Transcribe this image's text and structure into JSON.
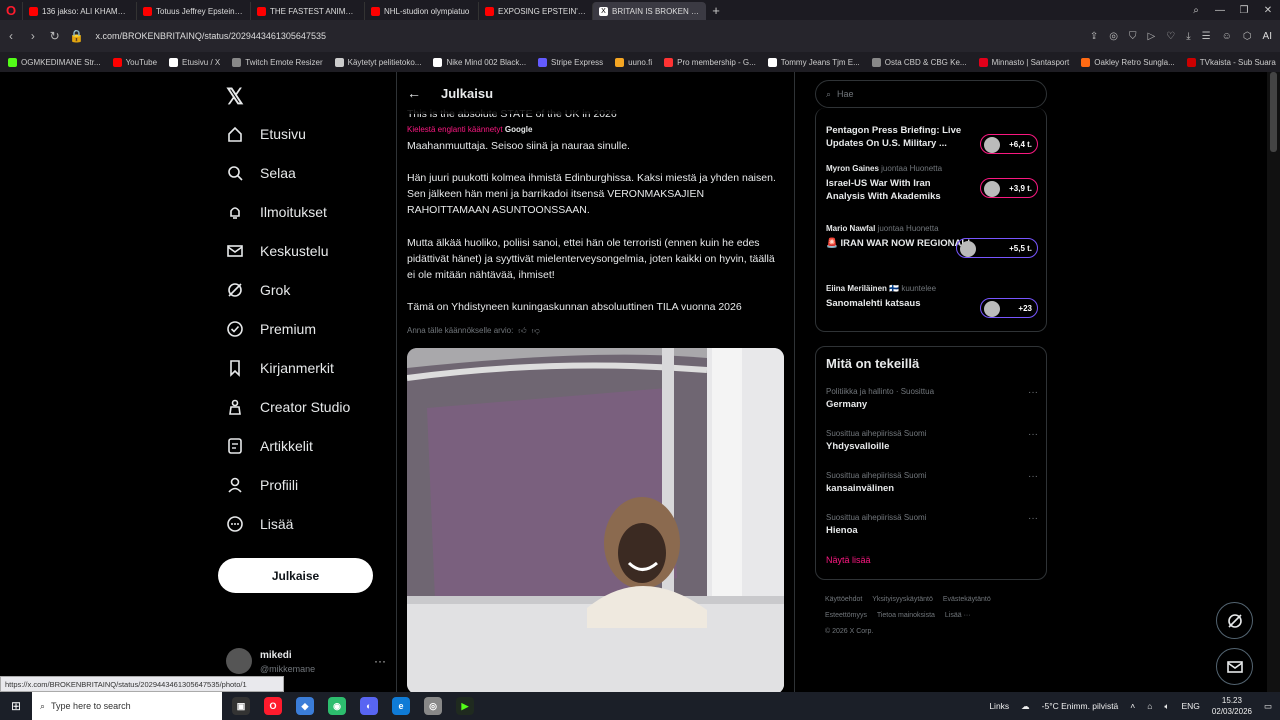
{
  "tabs": [
    {
      "label": "136 jakso: ALI KHAMENEI",
      "icon": "youtube-icon",
      "active": false
    },
    {
      "label": "Totuus Jeffrey Epsteinin K",
      "icon": "youtube-icon",
      "active": false
    },
    {
      "label": "THE FASTEST ANIMATRON",
      "icon": "youtube-icon",
      "active": false
    },
    {
      "label": "NHL-studion olympiatuo",
      "icon": "youtube-icon",
      "active": false
    },
    {
      "label": "EXPOSING EPSTEIN'S ZOR",
      "icon": "youtube-icon",
      "active": false
    },
    {
      "label": "BRITAIN IS BROKEN 🇬🇧 X",
      "icon": "x-icon",
      "active": true
    }
  ],
  "address": {
    "url": "x.com/BROKENBRITAINQ/status/2029443461305647535",
    "ai_label": "AI"
  },
  "bookmarks": [
    {
      "label": "OGMKEDIMANE Str...",
      "color": "#53fc18"
    },
    {
      "label": "YouTube",
      "color": "#ff0000"
    },
    {
      "label": "Etusivu / X",
      "color": "#ffffff"
    },
    {
      "label": "Twitch Emote Resizer",
      "color": "#888888"
    },
    {
      "label": "Käytetyt pelitietoko...",
      "color": "#cccccc"
    },
    {
      "label": "Nike Mind 002 Black...",
      "color": "#ffffff"
    },
    {
      "label": "Stripe Express",
      "color": "#635bff"
    },
    {
      "label": "uuno.fi",
      "color": "#f5a623"
    },
    {
      "label": "Pro membership - G...",
      "color": "#ff3333"
    },
    {
      "label": "Tommy Jeans Tjm E...",
      "color": "#ffffff"
    },
    {
      "label": "Osta CBD & CBG Ke...",
      "color": "#888888"
    },
    {
      "label": "Minnasto | Santasport",
      "color": "#e2001a"
    },
    {
      "label": "Oakley Retro Sungla...",
      "color": "#ff6a13"
    },
    {
      "label": "TVkaista - Sub Suara",
      "color": "#cc0000"
    }
  ],
  "nav": [
    {
      "label": "Etusivu",
      "icon": "home-icon"
    },
    {
      "label": "Selaa",
      "icon": "search-icon"
    },
    {
      "label": "Ilmoitukset",
      "icon": "bell-icon"
    },
    {
      "label": "Keskustelu",
      "icon": "mail-icon"
    },
    {
      "label": "Grok",
      "icon": "grok-icon"
    },
    {
      "label": "Premium",
      "icon": "premium-icon"
    },
    {
      "label": "Kirjanmerkit",
      "icon": "bookmark-icon"
    },
    {
      "label": "Creator Studio",
      "icon": "creator-icon"
    },
    {
      "label": "Artikkelit",
      "icon": "article-icon"
    },
    {
      "label": "Profiili",
      "icon": "profile-icon"
    },
    {
      "label": "Lisää",
      "icon": "more-icon"
    }
  ],
  "post_button": "Julkaise",
  "account": {
    "name": "mikedi",
    "handle": "@mikkemane"
  },
  "tweet": {
    "header": "Julkaisu",
    "original_line": "This is the absolute STATE of the UK in 2026",
    "translated_from": "Kielestä englanti käännetyt",
    "translated_by": "Google",
    "para1": "Maahanmuuttaja. Seisoo siinä ja nauraa sinulle.",
    "para2": "Hän juuri puukotti kolmea ihmistä Edinburghissa. Kaksi miestä ja yhden naisen. Sen jälkeen hän meni ja barrikadoi itsensä VERONMAKSAJIEN RAHOITTAMAAN ASUNTOONSSAAN.",
    "para3": "Mutta älkää huoliko, poliisi sanoi, ettei hän ole terroristi (ennen kuin he edes pidättivät hänet) ja syyttivät mielenterveysongelmia, joten kaikki on hyvin, täällä ei ole mitään nähtävää, ihmiset!",
    "para4": "Tämä on Yhdistyneen kuningaskunnan absoluuttinen TILA vuonna 2026",
    "rate_prompt": "Anna tälle käännökselle arvio:"
  },
  "search": {
    "placeholder": "Hae"
  },
  "live": [
    {
      "host": "",
      "host_suffix": "",
      "title": "Pentagon Press Briefing: Live Updates On U.S. Military ...",
      "count": "+6,4 t."
    },
    {
      "host": "Myron Gaines",
      "host_suffix": "juontaa Huonetta",
      "title": "Israel-US War With Iran Analysis With Akademiks",
      "count": "+3,9 t."
    },
    {
      "host": "Mario Nawfal",
      "host_suffix": "juontaa Huonetta",
      "title": "🚨 IRAN WAR NOW REGIONAL!",
      "count": "+5,5 t."
    },
    {
      "host": "Eiina Meriläinen 🇫🇮",
      "host_suffix": "kuuntelee",
      "title": "Sanomalehti katsaus",
      "count": "+23"
    }
  ],
  "trends": {
    "heading": "Mitä on tekeillä",
    "items": [
      {
        "context": "Politiikka ja hallinto · Suosittua",
        "name": "Germany"
      },
      {
        "context": "Suosittua aihepiirissä Suomi",
        "name": "Yhdysvalloille"
      },
      {
        "context": "Suosittua aihepiirissä Suomi",
        "name": "kansainvälinen"
      },
      {
        "context": "Suosittua aihepiirissä Suomi",
        "name": "Hienoa"
      }
    ],
    "show_more": "Näytä lisää"
  },
  "footer": [
    "Käyttöehdot",
    "Yksityisyyskäytäntö",
    "Evästekäytäntö",
    "Esteettömyys",
    "Tietoa mainoksista",
    "Lisää ···",
    "© 2026 X Corp."
  ],
  "status_url": "https://x.com/BROKENBRITAINQ/status/2029443461305647535/photo/1",
  "taskbar": {
    "search_placeholder": "Type here to search",
    "links": "Links",
    "weather": "-5°C  Enimm. pilvistä",
    "lang": "ENG",
    "time": "15.23",
    "date": "02/03/2026"
  }
}
